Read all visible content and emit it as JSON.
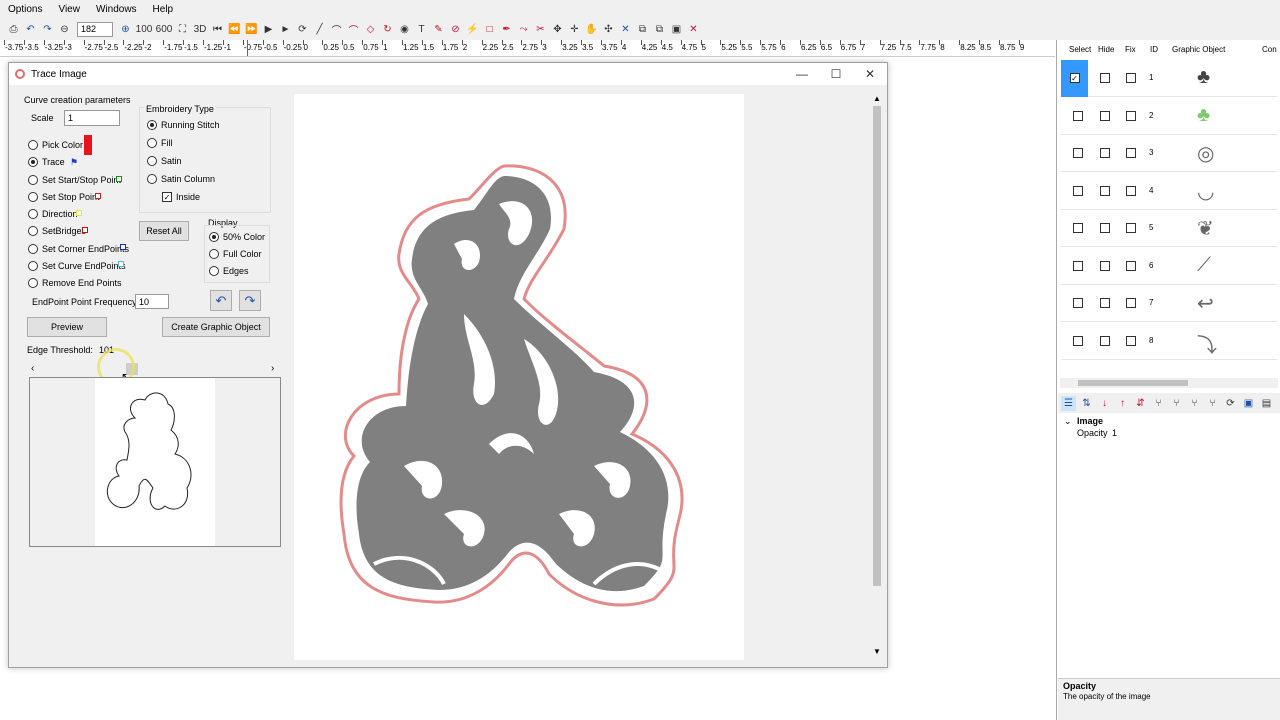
{
  "menu": [
    "Options",
    "View",
    "Windows",
    "Help"
  ],
  "toolbar": {
    "zoom_value": "182",
    "zoom_100": "100",
    "zoom_600": "600",
    "view_3d": "3D"
  },
  "ruler": {
    "ticks": [
      "-3.75",
      "-3.5",
      "-3.25",
      "-3",
      "-2.75",
      "-2.5",
      "-2.25",
      "-2",
      "-1.75",
      "-1.5",
      "-1.25",
      "-1",
      "-0.75",
      "-0.5",
      "-0.25",
      "0",
      "0.25",
      "0.5",
      "0.75",
      "1",
      "1.25",
      "1.5",
      "1.75",
      "2",
      "2.25",
      "2.5",
      "2.75",
      "3",
      "3.25",
      "3.5",
      "3.75",
      "4",
      "4.25",
      "4.5",
      "4.75",
      "5",
      "5.25",
      "5.5",
      "5.75",
      "6",
      "6.25",
      "6.5",
      "6.75",
      "7",
      "7.25",
      "7.5",
      "7.75",
      "8",
      "8.25",
      "8.5",
      "8.75",
      "9"
    ]
  },
  "dialog": {
    "title": "Trace Image",
    "curve_params": "Curve creation parameters",
    "scale_label": "Scale",
    "scale_value": "1",
    "options": [
      {
        "label": "Pick Color",
        "on": false
      },
      {
        "label": "Trace",
        "on": true
      },
      {
        "label": "Set Start/Stop Point",
        "on": false
      },
      {
        "label": "Set Stop Point",
        "on": false
      },
      {
        "label": "Direction",
        "on": false
      },
      {
        "label": "SetBridges",
        "on": false
      },
      {
        "label": "Set Corner EndPoints",
        "on": false
      },
      {
        "label": "Set Curve EndPoints",
        "on": false
      },
      {
        "label": "Remove End Points",
        "on": false
      }
    ],
    "embroidery_type": "Embroidery Type",
    "embroidery_options": [
      {
        "label": "Running Stitch",
        "on": true
      },
      {
        "label": "Fill",
        "on": false
      },
      {
        "label": "Satin",
        "on": false
      },
      {
        "label": "Satin Column",
        "on": false
      }
    ],
    "inside_label": "Inside",
    "reset_all": "Reset All",
    "display_label": "Display",
    "display_options": [
      {
        "label": "50% Color",
        "on": true
      },
      {
        "label": "Full Color",
        "on": false
      },
      {
        "label": "Edges",
        "on": false
      }
    ],
    "endpoint_freq_label": "EndPoint Point Frequency:",
    "endpoint_freq_value": "10",
    "preview_btn": "Preview",
    "create_btn": "Create Graphic Object",
    "edge_threshold_label": "Edge Threshold:",
    "edge_threshold_value": "101",
    "colors": {
      "pick": "#e8141c",
      "trace": "#1f3fbf",
      "start_stop": "#1a8f1a",
      "stop": "#d42020",
      "direction": "#e8e830",
      "bridges": "#c01010",
      "corner": "#1030c0",
      "curve": "#60b0e0"
    }
  },
  "panel": {
    "headers": [
      "Select",
      "Hide",
      "Fix",
      "ID",
      "Graphic Object",
      "Con"
    ],
    "rows": [
      {
        "id": "1",
        "selected": true,
        "thumb": "a-letter-icon"
      },
      {
        "id": "2",
        "selected": false,
        "thumb": "green-shape-icon"
      },
      {
        "id": "3",
        "selected": false,
        "thumb": "swirl-icon"
      },
      {
        "id": "4",
        "selected": false,
        "thumb": "curve-icon"
      },
      {
        "id": "5",
        "selected": false,
        "thumb": "leaf-icon"
      },
      {
        "id": "6",
        "selected": false,
        "thumb": "stroke-icon"
      },
      {
        "id": "7",
        "selected": false,
        "thumb": "hook-icon"
      },
      {
        "id": "8",
        "selected": false,
        "thumb": "curl-icon"
      }
    ],
    "props_section": "Image",
    "props": [
      {
        "name": "Opacity",
        "value": "1"
      }
    ],
    "desc_title": "Opacity",
    "desc_text": "The opacity of the image"
  }
}
